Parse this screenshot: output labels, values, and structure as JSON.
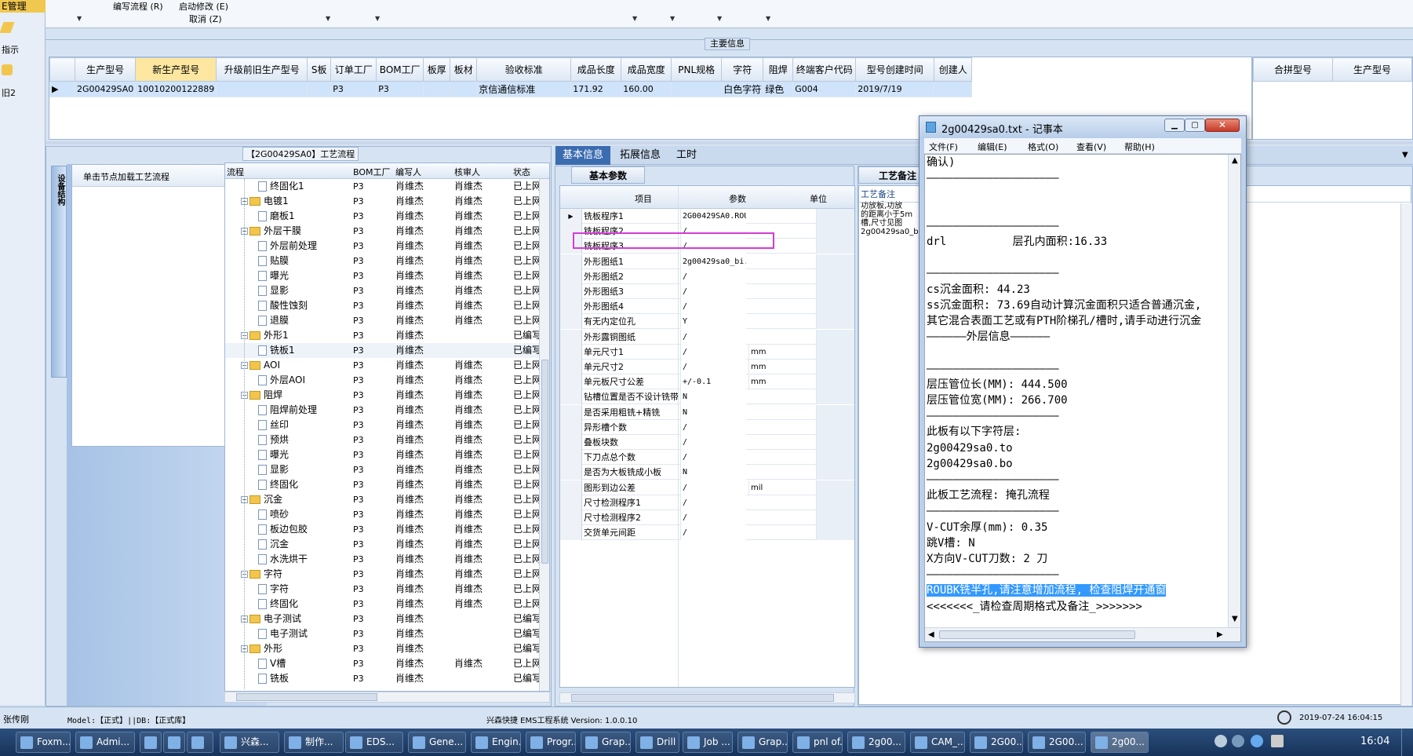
{
  "left_nav": {
    "header": "E管理",
    "item1": "指示",
    "item2": "旧2"
  },
  "toolbar": {
    "write_flow": "编写流程 (R)",
    "start_modify": "启动修改 (E)",
    "cancel": "取消 (Z)"
  },
  "main_info": {
    "title": "主要信息",
    "columns": [
      "生产型号",
      "新生产型号",
      "升级前旧生产型号",
      "S板",
      "订单工厂",
      "BOM工厂",
      "板厚",
      "板材",
      "验收标准",
      "成品长度",
      "成品宽度",
      "PNL规格",
      "字符",
      "阻焊",
      "终端客户代码",
      "型号创建时间",
      "创建人"
    ],
    "row": [
      "2G00429SA0",
      "10010200122889",
      "",
      "",
      "P3",
      "P3",
      "",
      "",
      "京信通信标准",
      "171.92",
      "160.00",
      "",
      "白色字符",
      "绿色",
      "G004",
      "2019/7/19",
      ""
    ],
    "merge_columns": [
      "合拼型号",
      "生产型号"
    ]
  },
  "process": {
    "title": "【2G00429SA0】工艺流程",
    "side_tab": "设备结构",
    "load_text": "单击节点加载工艺流程",
    "columns": [
      "流程",
      "BOM工厂",
      "编写人",
      "核审人",
      "状态"
    ],
    "rows": [
      {
        "level": 2,
        "type": "doc",
        "name": "终固化1",
        "bom": "P3",
        "writer": "肖维杰",
        "reviewer": "肖维杰",
        "status": "已上网"
      },
      {
        "level": 1,
        "type": "folder",
        "name": "电镀1",
        "bom": "P3",
        "writer": "肖维杰",
        "reviewer": "肖维杰",
        "status": "已上网"
      },
      {
        "level": 2,
        "type": "doc",
        "name": "磨板1",
        "bom": "P3",
        "writer": "肖维杰",
        "reviewer": "肖维杰",
        "status": "已上网"
      },
      {
        "level": 1,
        "type": "folder",
        "name": "外层干膜",
        "bom": "P3",
        "writer": "肖维杰",
        "reviewer": "肖维杰",
        "status": "已上网"
      },
      {
        "level": 2,
        "type": "doc",
        "name": "外层前处理",
        "bom": "P3",
        "writer": "肖维杰",
        "reviewer": "肖维杰",
        "status": "已上网"
      },
      {
        "level": 2,
        "type": "doc",
        "name": "贴膜",
        "bom": "P3",
        "writer": "肖维杰",
        "reviewer": "肖维杰",
        "status": "已上网"
      },
      {
        "level": 2,
        "type": "doc",
        "name": "曝光",
        "bom": "P3",
        "writer": "肖维杰",
        "reviewer": "肖维杰",
        "status": "已上网"
      },
      {
        "level": 2,
        "type": "doc",
        "name": "显影",
        "bom": "P3",
        "writer": "肖维杰",
        "reviewer": "肖维杰",
        "status": "已上网"
      },
      {
        "level": 2,
        "type": "doc",
        "name": "酸性蚀刻",
        "bom": "P3",
        "writer": "肖维杰",
        "reviewer": "肖维杰",
        "status": "已上网"
      },
      {
        "level": 2,
        "type": "doc",
        "name": "退膜",
        "bom": "P3",
        "writer": "肖维杰",
        "reviewer": "肖维杰",
        "status": "已上网"
      },
      {
        "level": 1,
        "type": "folder",
        "name": "外形1",
        "bom": "P3",
        "writer": "肖维杰",
        "reviewer": "",
        "status": "已编写"
      },
      {
        "level": 2,
        "type": "doc",
        "name": "铣板1",
        "bom": "P3",
        "writer": "肖维杰",
        "reviewer": "",
        "status": "已编写"
      },
      {
        "level": 1,
        "type": "folder",
        "name": "AOI",
        "bom": "P3",
        "writer": "肖维杰",
        "reviewer": "肖维杰",
        "status": "已上网"
      },
      {
        "level": 2,
        "type": "doc",
        "name": "外层AOI",
        "bom": "P3",
        "writer": "肖维杰",
        "reviewer": "肖维杰",
        "status": "已上网"
      },
      {
        "level": 1,
        "type": "folder",
        "name": "阻焊",
        "bom": "P3",
        "writer": "肖维杰",
        "reviewer": "肖维杰",
        "status": "已上网"
      },
      {
        "level": 2,
        "type": "doc",
        "name": "阻焊前处理",
        "bom": "P3",
        "writer": "肖维杰",
        "reviewer": "肖维杰",
        "status": "已上网"
      },
      {
        "level": 2,
        "type": "doc",
        "name": "丝印",
        "bom": "P3",
        "writer": "肖维杰",
        "reviewer": "肖维杰",
        "status": "已上网"
      },
      {
        "level": 2,
        "type": "doc",
        "name": "预烘",
        "bom": "P3",
        "writer": "肖维杰",
        "reviewer": "肖维杰",
        "status": "已上网"
      },
      {
        "level": 2,
        "type": "doc",
        "name": "曝光",
        "bom": "P3",
        "writer": "肖维杰",
        "reviewer": "肖维杰",
        "status": "已上网"
      },
      {
        "level": 2,
        "type": "doc",
        "name": "显影",
        "bom": "P3",
        "writer": "肖维杰",
        "reviewer": "肖维杰",
        "status": "已上网"
      },
      {
        "level": 2,
        "type": "doc",
        "name": "终固化",
        "bom": "P3",
        "writer": "肖维杰",
        "reviewer": "肖维杰",
        "status": "已上网"
      },
      {
        "level": 1,
        "type": "folder",
        "name": "沉金",
        "bom": "P3",
        "writer": "肖维杰",
        "reviewer": "肖维杰",
        "status": "已上网"
      },
      {
        "level": 2,
        "type": "doc",
        "name": "喷砂",
        "bom": "P3",
        "writer": "肖维杰",
        "reviewer": "肖维杰",
        "status": "已上网"
      },
      {
        "level": 2,
        "type": "doc",
        "name": "板边包胶",
        "bom": "P3",
        "writer": "肖维杰",
        "reviewer": "肖维杰",
        "status": "已上网"
      },
      {
        "level": 2,
        "type": "doc",
        "name": "沉金",
        "bom": "P3",
        "writer": "肖维杰",
        "reviewer": "肖维杰",
        "status": "已上网"
      },
      {
        "level": 2,
        "type": "doc",
        "name": "水洗烘干",
        "bom": "P3",
        "writer": "肖维杰",
        "reviewer": "肖维杰",
        "status": "已上网"
      },
      {
        "level": 1,
        "type": "folder",
        "name": "字符",
        "bom": "P3",
        "writer": "肖维杰",
        "reviewer": "肖维杰",
        "status": "已上网"
      },
      {
        "level": 2,
        "type": "doc",
        "name": "字符",
        "bom": "P3",
        "writer": "肖维杰",
        "reviewer": "肖维杰",
        "status": "已上网"
      },
      {
        "level": 2,
        "type": "doc",
        "name": "终固化",
        "bom": "P3",
        "writer": "肖维杰",
        "reviewer": "肖维杰",
        "status": "已上网"
      },
      {
        "level": 1,
        "type": "folder",
        "name": "电子测试",
        "bom": "P3",
        "writer": "肖维杰",
        "reviewer": "",
        "status": "已编写"
      },
      {
        "level": 2,
        "type": "doc",
        "name": "电子测试",
        "bom": "P3",
        "writer": "肖维杰",
        "reviewer": "",
        "status": "已编写"
      },
      {
        "level": 1,
        "type": "folder",
        "name": "外形",
        "bom": "P3",
        "writer": "肖维杰",
        "reviewer": "",
        "status": "已编写"
      },
      {
        "level": 2,
        "type": "doc",
        "name": "V槽",
        "bom": "P3",
        "writer": "肖维杰",
        "reviewer": "肖维杰",
        "status": "已上网"
      },
      {
        "level": 2,
        "type": "doc",
        "name": "铣板",
        "bom": "P3",
        "writer": "肖维杰",
        "reviewer": "",
        "status": "已编写"
      }
    ]
  },
  "tabs": [
    "基本信息",
    "拓展信息",
    "工时"
  ],
  "params": {
    "subtab": "基本参数",
    "columns": [
      "项目",
      "参数",
      "单位"
    ],
    "rows": [
      {
        "item": "铣板程序1",
        "value": "2G00429SA0.ROU",
        "unit": ""
      },
      {
        "item": "铣板程序2",
        "value": "/",
        "unit": ""
      },
      {
        "item": "铣板程序3",
        "value": "/",
        "unit": ""
      },
      {
        "item": "外形图纸1",
        "value": "2g00429sa0_bi...",
        "unit": ""
      },
      {
        "item": "外形图纸2",
        "value": "/",
        "unit": ""
      },
      {
        "item": "外形图纸3",
        "value": "/",
        "unit": ""
      },
      {
        "item": "外形图纸4",
        "value": "/",
        "unit": ""
      },
      {
        "item": "有无内定位孔",
        "value": "Y",
        "unit": ""
      },
      {
        "item": "外形露铜图纸",
        "value": "/",
        "unit": ""
      },
      {
        "item": "单元尺寸1",
        "value": "/",
        "unit": "mm"
      },
      {
        "item": "单元尺寸2",
        "value": "/",
        "unit": "mm"
      },
      {
        "item": "单元板尺寸公差",
        "value": "+/-0.1",
        "unit": "mm"
      },
      {
        "item": "钻槽位置是否不设计铣带",
        "value": "N",
        "unit": ""
      },
      {
        "item": "是否采用粗铣+精铣",
        "value": "N",
        "unit": ""
      },
      {
        "item": "异形槽个数",
        "value": "/",
        "unit": ""
      },
      {
        "item": "叠板块数",
        "value": "/",
        "unit": ""
      },
      {
        "item": "下刀点总个数",
        "value": "/",
        "unit": ""
      },
      {
        "item": "是否为大板铣成小板",
        "value": "N",
        "unit": ""
      },
      {
        "item": "图形到边公差",
        "value": "/",
        "unit": "mil"
      },
      {
        "item": "尺寸检测程序1",
        "value": "/",
        "unit": ""
      },
      {
        "item": "尺寸检测程序2",
        "value": "/",
        "unit": ""
      },
      {
        "item": "交货单元间距",
        "value": "/",
        "unit": ""
      }
    ]
  },
  "notes": {
    "tab": "工艺备注",
    "label": "工艺备注",
    "lines": [
      "功放板,功放",
      "的距离小于5m",
      "槽,尺寸见图",
      "2g00429sa0_bi"
    ]
  },
  "notepad": {
    "title": "2g00429sa0.txt - 记事本",
    "menu": [
      "文件(F)",
      "编辑(E)",
      "格式(O)",
      "查看(V)",
      "帮助(H)"
    ],
    "lines": [
      "确认)",
      "————————————————————",
      "",
      "",
      "————————————————————",
      "drl          层孔内面积:16.33",
      "",
      "————————————————————",
      "cs沉金面积: 44.23",
      "ss沉金面积: 73.69自动计算沉金面积只适合普通沉金,",
      "其它混合表面工艺或有PTH阶梯孔/槽时,请手动进行沉金",
      "——————外层信息——————",
      "",
      "————————————————————",
      "层压管位长(MM): 444.500",
      "层压管位宽(MM): 266.700",
      "————————————————————",
      "此板有以下字符层:",
      "2g00429sa0.to",
      "2g00429sa0.bo",
      "————————————————————",
      "此板工艺流程: 掩孔流程",
      "————————————————————",
      "V-CUT余厚(mm): 0.35",
      "跳V槽: N",
      "X方向V-CUT刀数: 2 刀",
      "————————————————————",
      "ROUBK铣半孔,请注意增加流程, 检查阻焊开通窗",
      "<<<<<<<_请检查周期格式及备注_>>>>>>>"
    ]
  },
  "statusbar": {
    "user": "张传刚",
    "model": "Model:【正式】||DB:【正式库】",
    "system": "兴森快捷 EMS工程系统 Version: 1.0.0.10",
    "datetime": "2019-07-24 16:04:15"
  },
  "taskbar": {
    "items": [
      "Foxm...",
      "Admi...",
      "",
      "",
      "",
      "兴森...",
      "制作...",
      "EDS...",
      "Gene...",
      "Engin...",
      "Progr...",
      "Grap...",
      "Drill T...",
      "Job ...",
      "Grap...",
      "pnl of...",
      "2g00...",
      "CAM_...",
      "2G00...",
      "2G00...",
      "2g00..."
    ],
    "clock": "16:04"
  }
}
